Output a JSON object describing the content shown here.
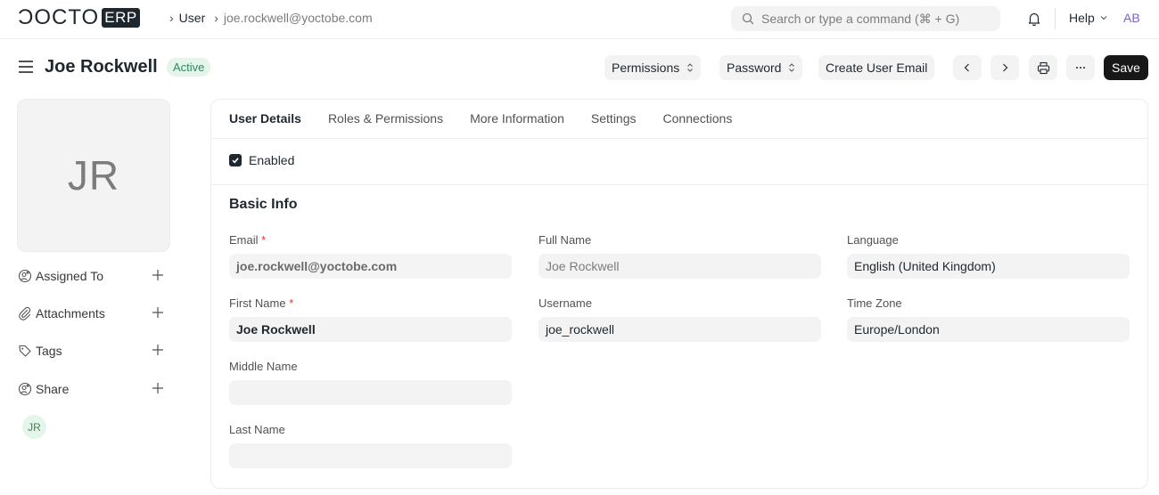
{
  "navbar": {
    "logo_text": "ƆOCTO",
    "logo_badge": "ERP",
    "breadcrumb": [
      "User",
      "joe.rockwell@yoctobe.com"
    ],
    "search_placeholder": "Search or type a command (⌘ + G)",
    "help_label": "Help",
    "user_initials": "AB"
  },
  "header": {
    "title": "Joe Rockwell",
    "status": "Active",
    "buttons": {
      "permissions": "Permissions",
      "password": "Password",
      "create_email": "Create User Email",
      "save": "Save"
    }
  },
  "sidebar": {
    "avatar_initials": "JR",
    "items": [
      {
        "label": "Assigned To",
        "icon": "user-add-icon"
      },
      {
        "label": "Attachments",
        "icon": "paperclip-icon"
      },
      {
        "label": "Tags",
        "icon": "tag-icon"
      },
      {
        "label": "Share",
        "icon": "user-add-icon"
      }
    ],
    "shared_user_initials": "JR"
  },
  "tabs": [
    "User Details",
    "Roles & Permissions",
    "More Information",
    "Settings",
    "Connections"
  ],
  "form": {
    "enabled_label": "Enabled",
    "enabled_checked": true,
    "section_title": "Basic Info",
    "fields": {
      "email": {
        "label": "Email",
        "required": "*",
        "value": "joe.rockwell@yoctobe.com"
      },
      "full_name": {
        "label": "Full Name",
        "value": "Joe Rockwell"
      },
      "language": {
        "label": "Language",
        "value": "English (United Kingdom)"
      },
      "first_name": {
        "label": "First Name",
        "required": "*",
        "value": "Joe Rockwell"
      },
      "username": {
        "label": "Username",
        "value": "joe_rockwell"
      },
      "time_zone": {
        "label": "Time Zone",
        "value": "Europe/London"
      },
      "middle_name": {
        "label": "Middle Name",
        "value": ""
      },
      "last_name": {
        "label": "Last Name",
        "value": ""
      }
    }
  },
  "colors": {
    "status_bg": "#e4f5e9",
    "status_text": "#278f5e",
    "primary_button": "#171717",
    "avatar_accent": "#7b5ed6"
  }
}
